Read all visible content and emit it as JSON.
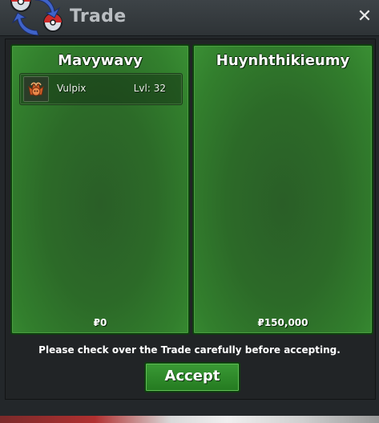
{
  "window": {
    "title": "Trade",
    "close_icon": "close-icon",
    "logo_icon": "trade-logo-icon"
  },
  "left_side": {
    "name": "Mavywavy",
    "money": "₽0",
    "items": [
      {
        "icon": "vulpix-icon",
        "name": "Vulpix",
        "level": "Lvl: 32"
      }
    ]
  },
  "right_side": {
    "name": "Huynhthikieumy",
    "money": "₽150,000",
    "items": []
  },
  "footer": {
    "notice": "Please check over the Trade carefully before accepting.",
    "accept_label": "Accept"
  },
  "colors": {
    "panel_green": "#2c6a28",
    "panel_border": "#0f3e0f",
    "window_bg": "#23272a",
    "title_text": "#b9bdc1"
  }
}
